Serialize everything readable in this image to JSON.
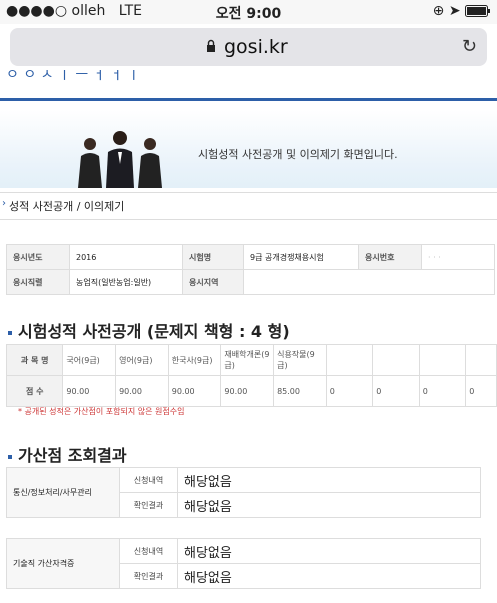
{
  "status": {
    "carrier": "●●●●○ olleh",
    "network": "LTE",
    "time": "오전 9:00",
    "icons": [
      "orientation-lock-icon",
      "location-arrow-icon",
      "battery-icon"
    ]
  },
  "browser": {
    "url": "gosi.kr",
    "lock_icon": "lock-icon",
    "reload_icon": "reload-icon"
  },
  "banner": {
    "message": "시험성적 사전공개 및 이의제기 화면입니다."
  },
  "breadcrumb": "성적 사전공개 / 이의제기",
  "info": {
    "year_label": "응시년도",
    "year": "2016",
    "exam_label": "시험명",
    "exam": "9급 공개경쟁채용시험",
    "number_label": "응시번호",
    "number": "·  ·  ·",
    "job_label": "응시직렬",
    "job": "농업직(일반농업:일반)",
    "place_label": "응시지역",
    "place": ""
  },
  "score_section": {
    "title": "시험성적 사전공개 (문제지 책형 : 4 형)",
    "subject_header": "과 목 명",
    "score_header": "점 수",
    "subjects": [
      "국어(9급)",
      "영어(9급)",
      "한국사(9급)",
      "재배학개론(9급)",
      "식용작물(9급)",
      "",
      "",
      "",
      ""
    ],
    "scores": [
      "90.00",
      "90.00",
      "90.00",
      "90.00",
      "85.00",
      "0",
      "0",
      "0",
      "0"
    ],
    "note": "* 공개된 성적은 가산점이 포함되지 않은 원점수임"
  },
  "bonus_section": {
    "title": "가산점 조회결과",
    "groups": [
      {
        "category": "통신/정보처리/사무관리",
        "request_label": "신청내역",
        "request_value": "해당없음",
        "confirm_label": "확인결과",
        "confirm_value": "해당없음"
      },
      {
        "category": "기술직 가산자격증",
        "request_label": "신청내역",
        "request_value": "해당없음",
        "confirm_label": "확인결과",
        "confirm_value": "해당없음"
      }
    ]
  },
  "colors": {
    "accent": "#2d5fa8",
    "note": "#cc3333"
  }
}
